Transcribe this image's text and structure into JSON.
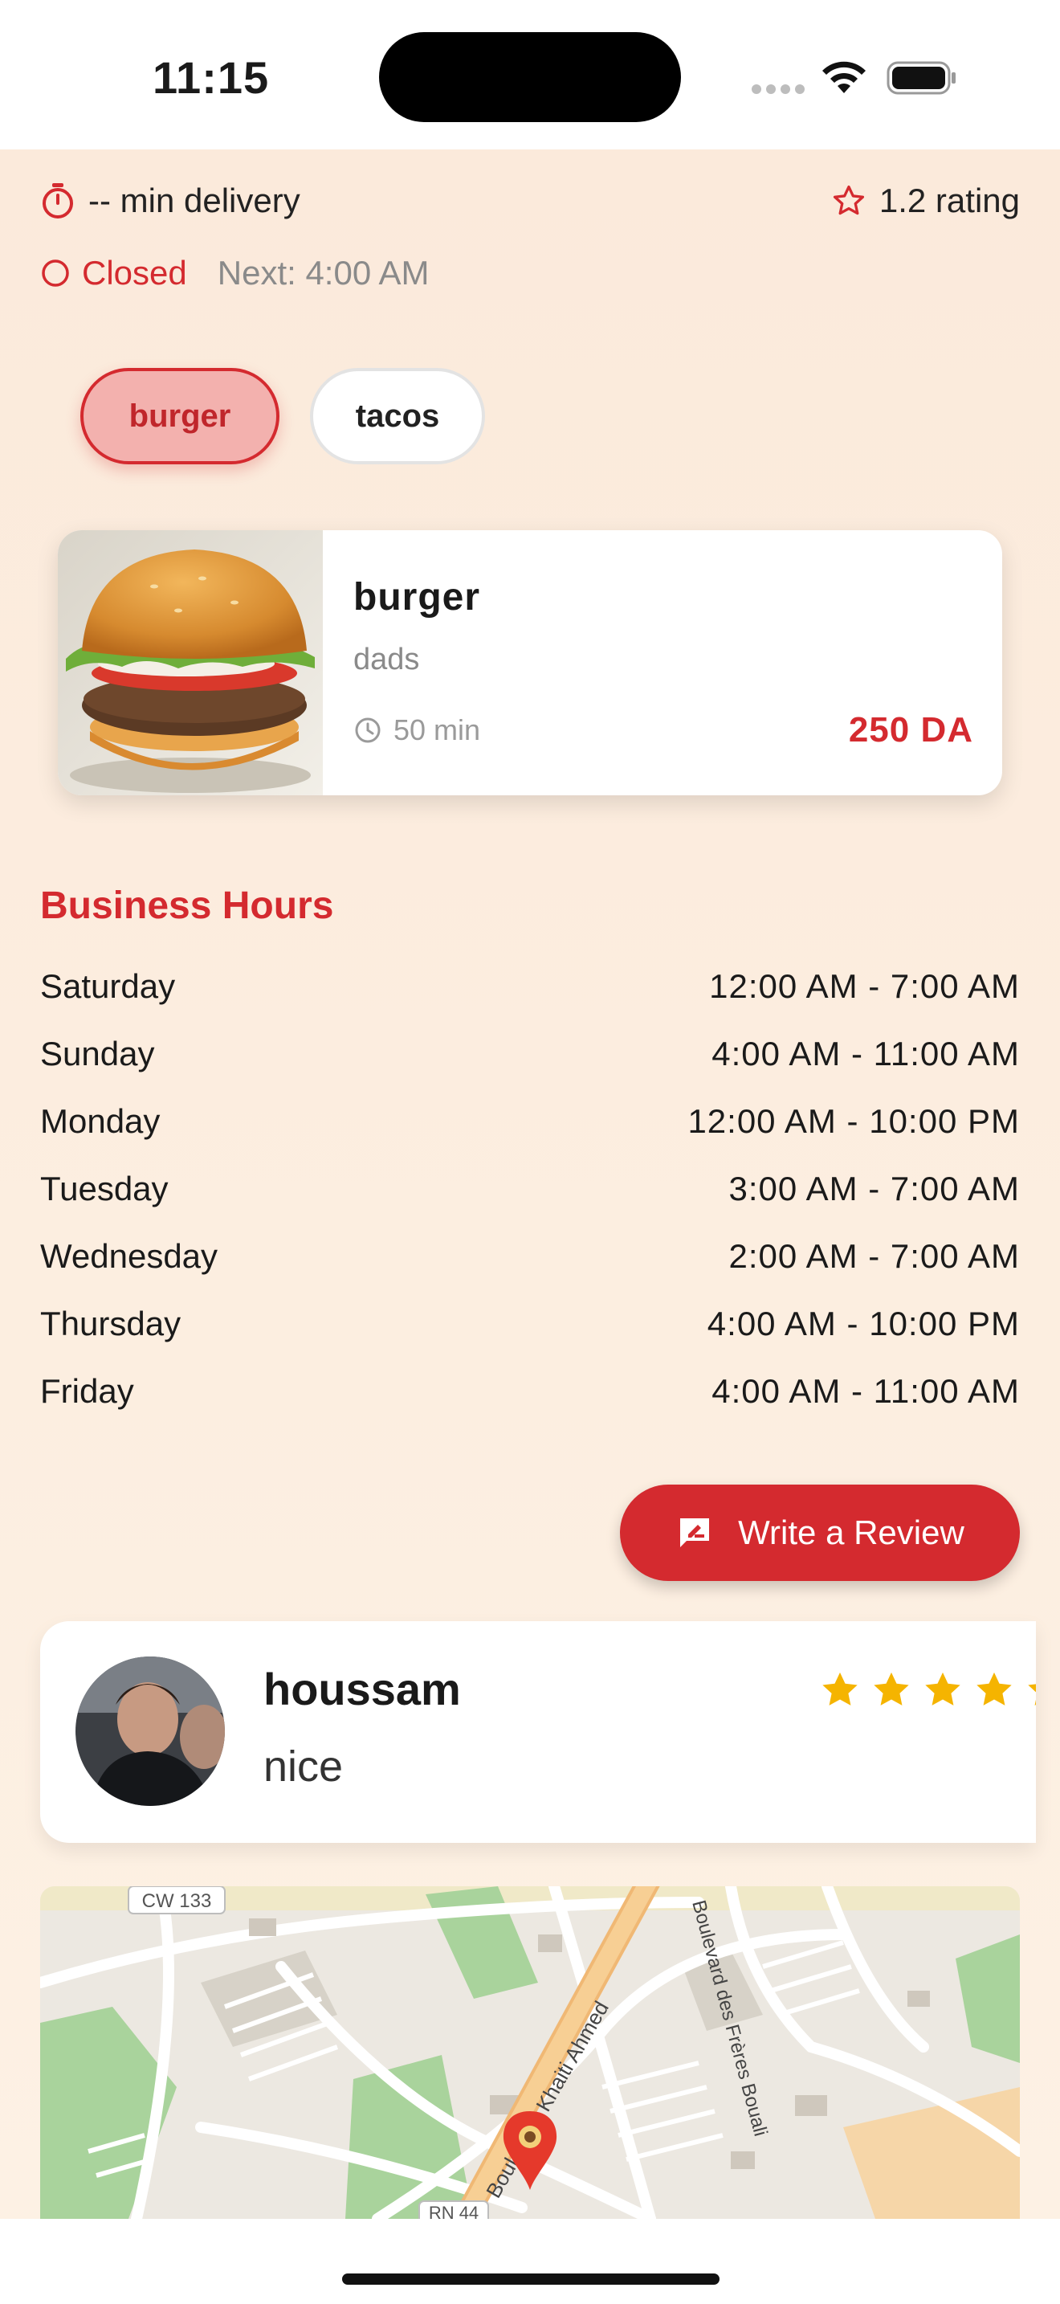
{
  "status_bar": {
    "time": "11:15"
  },
  "restaurant": {
    "delivery_text": "-- min delivery",
    "rating_text": "1.2 rating",
    "open_status": "Closed",
    "next_open": "Next: 4:00 AM"
  },
  "categories": [
    {
      "label": "burger",
      "selected": true
    },
    {
      "label": "tacos",
      "selected": false
    }
  ],
  "menu_item": {
    "title": "burger",
    "description": "dads",
    "time": "50 min",
    "price": "250 DA"
  },
  "business_hours": {
    "title": "Business Hours",
    "days": [
      {
        "day": "Saturday",
        "hours": "12:00 AM - 7:00 AM"
      },
      {
        "day": "Sunday",
        "hours": "4:00 AM - 11:00 AM"
      },
      {
        "day": "Monday",
        "hours": "12:00 AM - 10:00 PM"
      },
      {
        "day": "Tuesday",
        "hours": "3:00 AM - 7:00 AM"
      },
      {
        "day": "Wednesday",
        "hours": "2:00 AM - 7:00 AM"
      },
      {
        "day": "Thursday",
        "hours": "4:00 AM - 10:00 PM"
      },
      {
        "day": "Friday",
        "hours": "4:00 AM - 11:00 AM"
      }
    ]
  },
  "review_button": {
    "label": "Write a Review"
  },
  "review": {
    "name": "houssam",
    "text": "nice",
    "stars": 5
  },
  "map": {
    "labels": [
      "CW 133",
      "Boulevard Khaiti Ahmed",
      "Boulevard des Frères Bouali",
      "RN 44"
    ]
  },
  "colors": {
    "accent": "#d42a2f",
    "background": "#fcefe0",
    "star": "#f5b400"
  },
  "icons": [
    "timer-icon",
    "star-outline-icon",
    "circle-outline-icon",
    "clock-icon",
    "rate-review-icon",
    "star-icon",
    "map-pin-icon"
  ]
}
